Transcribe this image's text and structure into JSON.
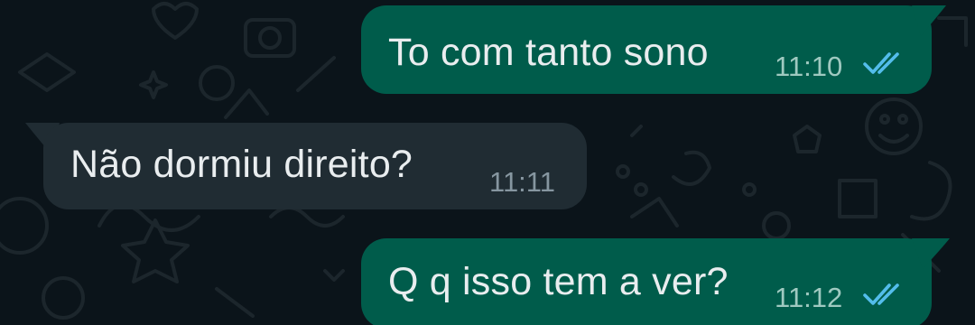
{
  "messages": [
    {
      "direction": "outgoing",
      "text": "To com tanto sono",
      "time": "11:10",
      "status": "read",
      "status_icon": "double-check-read-icon"
    },
    {
      "direction": "incoming",
      "text": "Não dormiu direito?",
      "time": "11:11"
    },
    {
      "direction": "outgoing",
      "text": "Q q isso tem a ver?",
      "time": "11:12",
      "status": "read",
      "status_icon": "double-check-read-icon"
    }
  ],
  "colors": {
    "background": "#0b141a",
    "outgoing_bubble": "#005c4b",
    "incoming_bubble": "#202c33",
    "message_text": "#e9edef",
    "outgoing_time": "#9fc9c0",
    "incoming_time": "#8696a0",
    "read_ticks": "#53bdeb"
  }
}
